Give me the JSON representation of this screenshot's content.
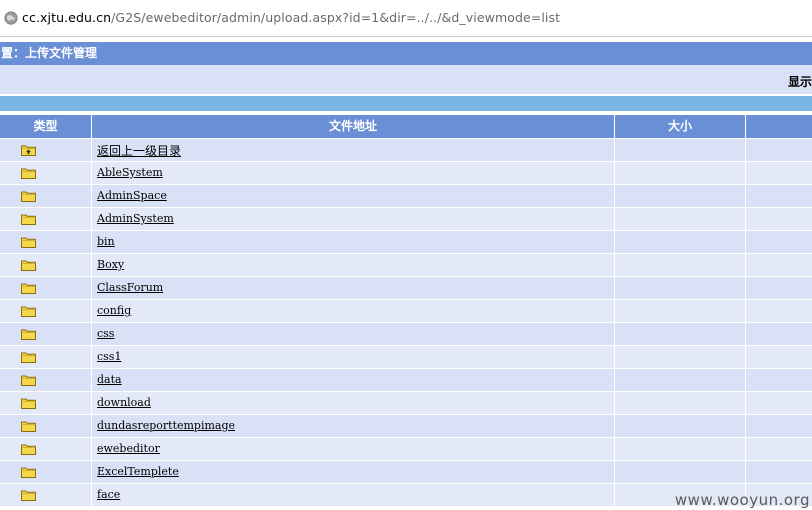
{
  "address_bar": {
    "url_host": "cc.xjtu.edu.cn",
    "url_rest": "/G2S/ewebeditor/admin/upload.aspx?id=1&dir=../../&d_viewmode=list"
  },
  "title_bar": {
    "text": "置：上传文件管理"
  },
  "sub_bar": {
    "show_label": "显示"
  },
  "table": {
    "headers": {
      "type": "类型",
      "address": "文件地址",
      "size": "大小"
    },
    "rows": [
      {
        "name": "返回上一级目录",
        "icon": "folder-up-icon"
      },
      {
        "name": "AbleSystem",
        "icon": "folder-icon"
      },
      {
        "name": "AdminSpace",
        "icon": "folder-icon"
      },
      {
        "name": "AdminSystem",
        "icon": "folder-icon"
      },
      {
        "name": "bin",
        "icon": "folder-icon"
      },
      {
        "name": "Boxy",
        "icon": "folder-icon"
      },
      {
        "name": "ClassForum",
        "icon": "folder-icon"
      },
      {
        "name": "config",
        "icon": "folder-icon"
      },
      {
        "name": "css",
        "icon": "folder-icon"
      },
      {
        "name": "css1",
        "icon": "folder-icon"
      },
      {
        "name": "data",
        "icon": "folder-icon"
      },
      {
        "name": "download",
        "icon": "folder-icon"
      },
      {
        "name": "dundasreporttempimage",
        "icon": "folder-icon"
      },
      {
        "name": "ewebeditor",
        "icon": "folder-icon"
      },
      {
        "name": "ExcelTemplete",
        "icon": "folder-icon"
      },
      {
        "name": "face",
        "icon": "folder-icon"
      }
    ]
  },
  "watermark": "www.wooyun.org",
  "colors": {
    "header_blue": "#6b8fd6",
    "row_bg": "#d9e1f7",
    "row_alt_bg": "#e3e9f9",
    "light_blue_bar": "#7bb5e6",
    "folder_yellow": "#f5d84a"
  }
}
